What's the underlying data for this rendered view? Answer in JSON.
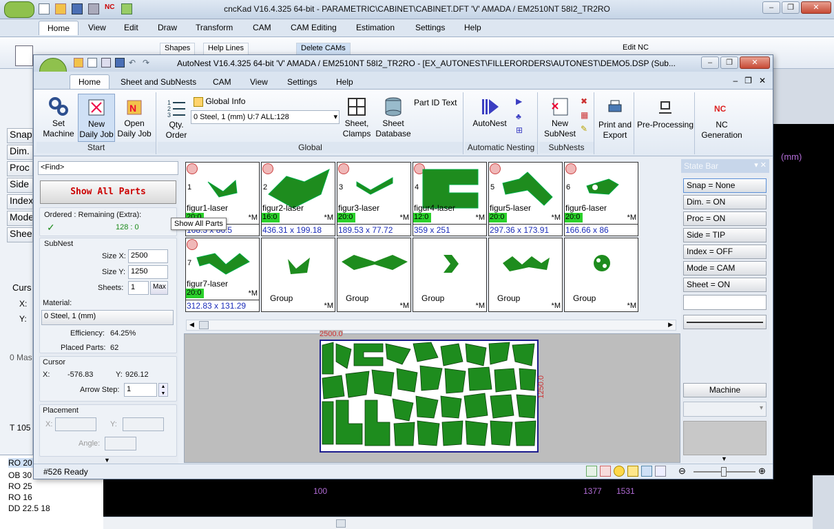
{
  "outer": {
    "title": "cncKad V16.4.325 64-bit - PARAMETRIC\\CABINET\\CABINET.DFT  'V'  AMADA / EM2510NT  58I2_TR2RO",
    "tabs": [
      "Home",
      "View",
      "Edit",
      "Draw",
      "Transform",
      "CAM",
      "CAM Editing",
      "Estimation",
      "Settings",
      "Help"
    ],
    "ribbon": {
      "shapes": "Shapes",
      "help_lines": "Help Lines",
      "delete_cams": "Delete CAMs",
      "edit_nc": "Edit NC"
    },
    "left_buttons": [
      "Snap",
      "Dim.",
      "Proc",
      "Side",
      "Index",
      "Mode",
      "Sheet"
    ],
    "cursor_label": "Curs",
    "x_label": "X:",
    "y_label": "Y:",
    "mass_text": "0 Mas",
    "t_text": "T 105",
    "bottom_list": [
      "RO 20",
      "OB 30",
      "RO 25",
      "RO 16",
      "DD 22.5 18"
    ],
    "units": "(mm)",
    "ruler": {
      "a": "100",
      "b": "1377",
      "c": "1531"
    }
  },
  "inner": {
    "title": "AutoNest V16.4.325 64-bit  'V'  AMADA / EM2510NT  58I2_TR2RO   - [EX_AUTONEST\\FILLERORDERS\\AUTONEST\\DEMO5.DSP (Sub...",
    "tabs": [
      "Home",
      "Sheet and SubNests",
      "CAM",
      "View",
      "Settings",
      "Help"
    ],
    "groups": {
      "start": {
        "label": "Start",
        "set_machine": "Set\nMachine",
        "new_daily_job": "New\nDaily Job",
        "open_daily_job": "Open\nDaily Job"
      },
      "global": {
        "label": "Global",
        "qty_order": "Qty.\nOrder",
        "global_info": "Global Info",
        "material_select": "0  Steel, 1 (mm)   U:7 ALL:128",
        "sheet_clamps": "Sheet,\nClamps",
        "sheet_database": "Sheet\nDatabase",
        "part_id_text": "Part ID Text"
      },
      "auto": {
        "label": "Automatic Nesting",
        "autonest": "AutoNest"
      },
      "subnests": {
        "label": "SubNests",
        "new_subnest": "New\nSubNest"
      },
      "print_export": "Print and\nExport",
      "preprocessing": "Pre-Processing",
      "nc_generation": "NC\nGeneration"
    },
    "find_placeholder": "<Find>",
    "show_all_parts": "Show All Parts",
    "ordered_label": "Ordered : Remaining (Extra):",
    "ordered_value": "128 : 0",
    "check": "✓",
    "subnest": {
      "title": "SubNest",
      "size_x_label": "Size X:",
      "size_x": "2500",
      "size_y_label": "Size Y:",
      "size_y": "1250",
      "sheets_label": "Sheets:",
      "sheets": "1",
      "max": "Max"
    },
    "material": {
      "title": "Material:",
      "value": "0  Steel, 1 (mm)"
    },
    "efficiency": {
      "label": "Efficiency:",
      "value": "64.25%"
    },
    "placed": {
      "label": "Placed Parts:",
      "value": "62"
    },
    "cursor": {
      "title": "Cursor",
      "x_label": "X:",
      "x": "-576.83",
      "y_label": "Y:",
      "y": "926.12",
      "arrow_label": "Arrow Step:",
      "arrow": "1"
    },
    "placement": {
      "title": "Placement",
      "x_label": "X:",
      "y_label": "Y:",
      "angle_label": "Angle:"
    },
    "tooltip": "Show All Parts",
    "parts": [
      {
        "num": "1",
        "name": "figur1-laser",
        "qty": "20:0",
        "m": "*M",
        "dim": "168.3 x 86.5"
      },
      {
        "num": "2",
        "name": "figur2-laser",
        "qty": "16:0",
        "m": "*M",
        "dim": "436.31 x 199.18"
      },
      {
        "num": "3",
        "name": "figur3-laser",
        "qty": "20:0",
        "m": "*M",
        "dim": "189.53 x 77.72"
      },
      {
        "num": "4",
        "name": "figur4-laser",
        "qty": "12:0",
        "m": "*M",
        "dim": "359 x 251"
      },
      {
        "num": "5",
        "name": "figur5-laser",
        "qty": "20:0",
        "m": "*M",
        "dim": "297.36 x 173.91"
      },
      {
        "num": "6",
        "name": "figur6-laser",
        "qty": "20:0",
        "m": "*M",
        "dim": "166.66 x 86"
      },
      {
        "num": "7",
        "name": "figur7-laser",
        "qty": "20:0",
        "m": "*M",
        "dim": "312.83 x 131.29"
      }
    ],
    "groups_row": [
      {
        "label": "Group",
        "m": "*M"
      },
      {
        "label": "Group",
        "m": "*M"
      },
      {
        "label": "Group",
        "m": "*M"
      },
      {
        "label": "Group",
        "m": "*M"
      },
      {
        "label": "Group",
        "m": "*M"
      }
    ],
    "sheet": {
      "width_label": "2500.0",
      "height_label": "1250.0"
    },
    "state_bar": {
      "title": "State Bar",
      "buttons": [
        "Snap = None",
        "Dim. = ON",
        "Proc = ON",
        "Side = TIP",
        "Index = OFF",
        "Mode = CAM",
        "Sheet = ON"
      ],
      "machine": "Machine"
    },
    "status": "#526 Ready"
  },
  "colors": {
    "part_green": "#1e8c1e",
    "qty_green": "#2bd12b",
    "dim_blue": "#1a2bb8",
    "show_all_red": "#cc0000"
  }
}
